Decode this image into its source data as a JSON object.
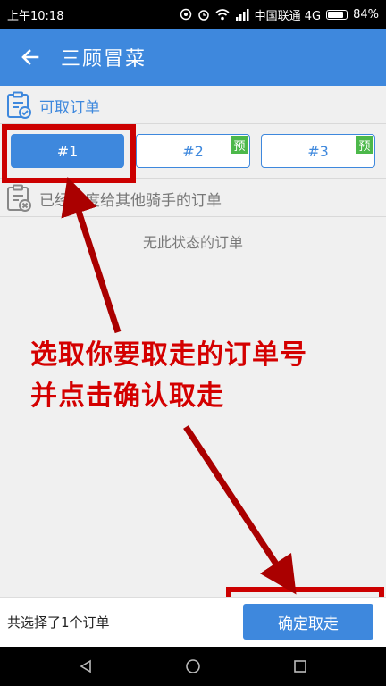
{
  "status_bar": {
    "time": "上午10:18",
    "carrier": "中国联通 4G",
    "battery": "84%",
    "battery_level": 0.84
  },
  "app_bar": {
    "title": "三顾冒菜"
  },
  "available_section": {
    "label": "可取订单",
    "icon": "clipboard-check-icon"
  },
  "orders": [
    {
      "label": "#1",
      "selected": true,
      "badge": ""
    },
    {
      "label": "#2",
      "selected": false,
      "badge": "预"
    },
    {
      "label": "#3",
      "selected": false,
      "badge": "预"
    }
  ],
  "dispatched_section": {
    "label": "已经调度给其他骑手的订单",
    "icon": "clipboard-x-icon",
    "empty_text": "无此状态的订单"
  },
  "annotation": {
    "line1": "选取你要取走的订单号",
    "line2": "并点击确认取走",
    "color": "#d40000"
  },
  "bottom_bar": {
    "selected_count": "共选择了1个订单",
    "confirm_label": "确定取走"
  },
  "colors": {
    "primary": "#3e88dd",
    "badge": "#4cb84a",
    "highlight": "#cc0000"
  }
}
